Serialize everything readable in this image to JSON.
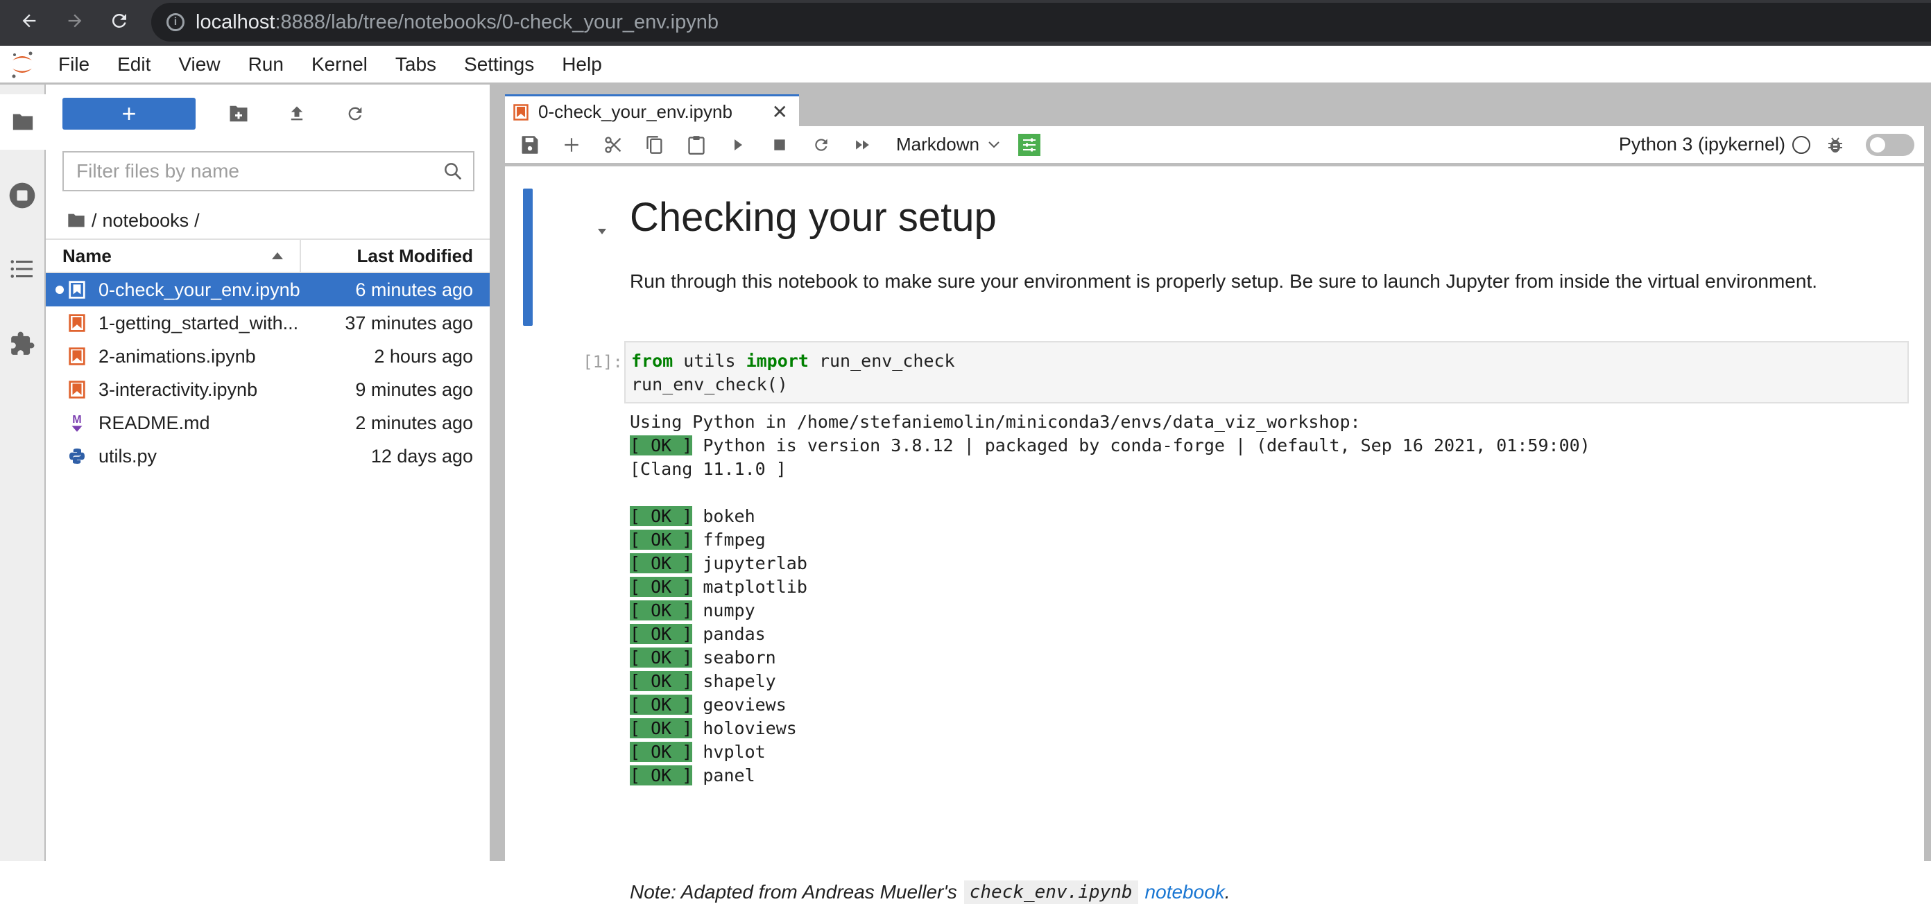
{
  "browser": {
    "url_host": "localhost",
    "url_rest": ":8888/lab/tree/notebooks/0-check_your_env.ipynb"
  },
  "menu": [
    "File",
    "Edit",
    "View",
    "Run",
    "Kernel",
    "Tabs",
    "Settings",
    "Help"
  ],
  "filebrowser": {
    "new_button_label": "+",
    "filter_placeholder": "Filter files by name",
    "breadcrumb_root": "/",
    "breadcrumb_folder": "notebooks",
    "breadcrumb_trail": "/",
    "col_name": "Name",
    "col_modified": "Last Modified",
    "files": [
      {
        "name": "0-check_your_env.ipynb",
        "modified": "6 minutes ago",
        "type": "notebook",
        "selected": true,
        "running": true
      },
      {
        "name": "1-getting_started_with...",
        "modified": "37 minutes ago",
        "type": "notebook"
      },
      {
        "name": "2-animations.ipynb",
        "modified": "2 hours ago",
        "type": "notebook"
      },
      {
        "name": "3-interactivity.ipynb",
        "modified": "9 minutes ago",
        "type": "notebook"
      },
      {
        "name": "README.md",
        "modified": "2 minutes ago",
        "type": "markdown"
      },
      {
        "name": "utils.py",
        "modified": "12 days ago",
        "type": "python"
      }
    ]
  },
  "notebook": {
    "tab_title": "0-check_your_env.ipynb",
    "cell_type": "Markdown",
    "kernel_name": "Python 3 (ipykernel)",
    "heading": "Checking your setup",
    "intro": "Run through this notebook to make sure your environment is properly setup. Be sure to launch Jupyter from inside the virtual environment.",
    "prompt": "[1]:",
    "code": {
      "kw_from": "from",
      "module": " utils ",
      "kw_import": "import",
      "name": " run_env_check",
      "line2": "run_env_check()"
    },
    "output": {
      "line1": "Using Python in /home/stefaniemolin/miniconda3/envs/data_viz_workshop:",
      "ok_tag": "[ OK ]",
      "python_line": " Python is version 3.8.12 | packaged by conda-forge | (default, Sep 16 2021, 01:59:00)",
      "clang_line": "[Clang 11.1.0 ]",
      "packages": [
        "bokeh",
        "ffmpeg",
        "jupyterlab",
        "matplotlib",
        "numpy",
        "pandas",
        "seaborn",
        "shapely",
        "geoviews",
        "holoviews",
        "hvplot",
        "panel"
      ]
    },
    "note": {
      "prefix": "Note: Adapted from Andreas Mueller's",
      "code": "check_env.ipynb",
      "link": "notebook",
      "suffix": "."
    }
  },
  "colors": {
    "accent": "#3573c7",
    "ok_green": "#4a9f5a",
    "notebook_orange": "#e0622d",
    "markdown_purple": "#7b3fb0",
    "python_blue": "#2f5fa7"
  }
}
